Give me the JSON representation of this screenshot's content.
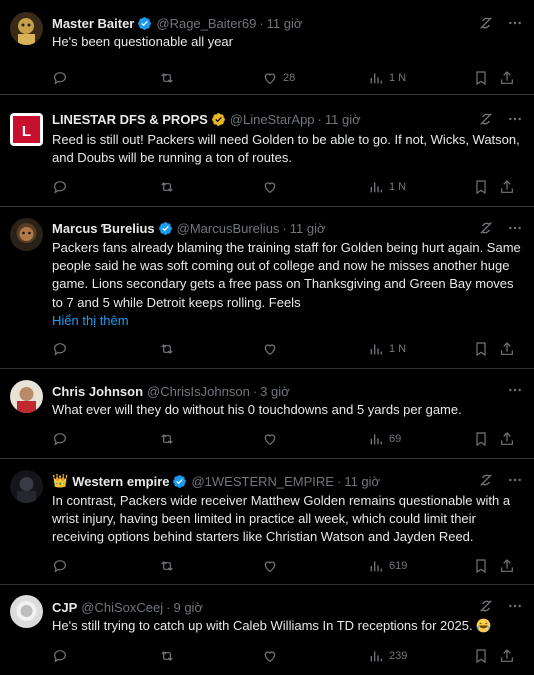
{
  "tweets": [
    {
      "name": "Master Baiter",
      "handle": "@Rage_Baiter69",
      "time": "11 giờ",
      "text": "He's been questionable all year",
      "show_more": "",
      "likes": "28",
      "views": "1 N",
      "verified": true
    },
    {
      "name": "LINESTAR DFS & PROPS",
      "handle": "@LineStarApp",
      "time": "11 giờ",
      "text": "Reed is still out! Packers will need Golden to be able to go. If not, Wicks, Watson, and Doubs will be running a ton of routes.",
      "show_more": "",
      "likes": "",
      "views": "1 N",
      "verified": true
    },
    {
      "name": "Marcus Ɓurelius",
      "handle": "@MarcusBurelius",
      "time": "11 giờ",
      "text": "Packers fans already blaming the training staff for Golden being hurt again. Same people said he was soft coming out of college and now he misses another huge game. Lions secondary gets a free pass on Thanksgiving and Green Bay moves to 7 and 5 while Detroit keeps rolling. Feels",
      "show_more": "Hiển thị thêm",
      "likes": "",
      "views": "1 N",
      "verified": true
    },
    {
      "name": "Chris Johnson",
      "handle": "@ChrisIsJohnson",
      "time": "3 giờ",
      "text": "What ever will they do without his 0 touchdowns and 5 yards per game.",
      "show_more": "",
      "likes": "",
      "views": "69",
      "verified": false
    },
    {
      "name": "Western empire",
      "handle": "@1WESTERN_EMPIRE",
      "time": "11 giờ",
      "text": "In contrast, Packers wide receiver Matthew Golden remains questionable with a wrist injury, having been limited in practice all week, which could limit their receiving options behind starters like Christian Watson and Jayden Reed.",
      "show_more": "",
      "likes": "",
      "views": "619",
      "verified": true,
      "crown": "👑"
    },
    {
      "name": "CJP",
      "handle": "@ChiSoxCeej",
      "time": "9 giờ",
      "text": "He's still trying to catch up with Caleb Williams In TD receptions for 2025.",
      "show_more": "",
      "likes": "",
      "views": "239",
      "verified": false
    }
  ],
  "colors": {
    "background": "#000000",
    "text": "#e7e9ea",
    "muted": "#71767b",
    "link": "#1d9bf0",
    "verified": "#1d9bf0",
    "verified_gold": "#e8b829"
  }
}
